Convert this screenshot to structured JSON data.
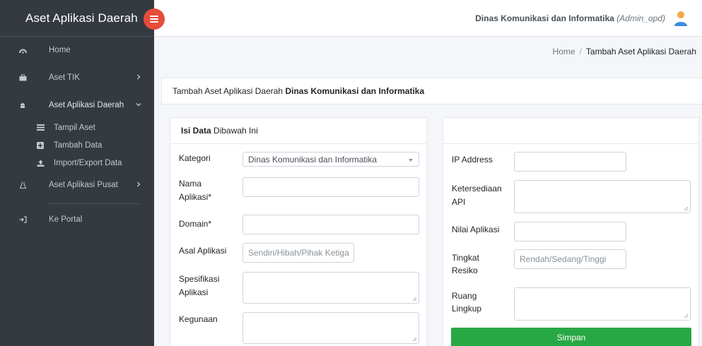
{
  "app": {
    "brand": "Aset Aplikasi Daerah"
  },
  "sidebar": {
    "items": [
      {
        "label": "Home",
        "icon": "dashboard-icon"
      },
      {
        "label": "Aset TIK",
        "icon": "briefcase-icon"
      },
      {
        "label": "Aset Aplikasi Daerah",
        "icon": "android-icon"
      },
      {
        "label": "Aset Aplikasi Pusat",
        "icon": "flask-icon"
      },
      {
        "label": "Ke Portal",
        "icon": "sign-in-icon"
      }
    ],
    "subitems": [
      {
        "label": "Tampil Aset",
        "icon": "list-icon"
      },
      {
        "label": "Tambah Data",
        "icon": "plus-square-icon"
      },
      {
        "label": "Import/Export Data",
        "icon": "upload-icon"
      }
    ]
  },
  "topbar": {
    "org": "Dinas Komunikasi dan Informatika",
    "role": "(Admin_opd)"
  },
  "breadcrumb": {
    "home": "Home",
    "sep": "/",
    "current": "Tambah Aset Aplikasi Daerah"
  },
  "title": {
    "prefix": "Tambah Aset Aplikasi Daerah",
    "org": "Dinas Komunikasi dan Informatika"
  },
  "left_card": {
    "header_bold": "Isi Data",
    "header_rest": "Dibawah Ini",
    "fields": {
      "kategori": {
        "label": "Kategori",
        "value": "Dinas Komunikasi dan Informatika"
      },
      "nama": {
        "label1": "Nama",
        "label2": "Aplikasi*",
        "value": ""
      },
      "domain": {
        "label": "Domain*",
        "value": ""
      },
      "asal": {
        "label": "Asal Aplikasi",
        "placeholder": "Sendiri/Hibah/Pihak Ketiga"
      },
      "spesifikasi": {
        "label1": "Spesifikasi",
        "label2": "Aplikasi",
        "value": ""
      },
      "kegunaan": {
        "label": "Kegunaan",
        "value": ""
      }
    }
  },
  "right_card": {
    "fields": {
      "ip": {
        "label": "IP Address",
        "value": ""
      },
      "api": {
        "label1": "Ketersediaan",
        "label2": "API",
        "value": ""
      },
      "nilai": {
        "label": "Nilai Aplikasi",
        "value": ""
      },
      "resiko": {
        "label1": "Tingkat",
        "label2": "Resiko",
        "placeholder": "Rendah/Sedang/Tinggi"
      },
      "ruang": {
        "label1": "Ruang",
        "label2": "Lingkup",
        "value": ""
      }
    },
    "save_label": "Simpan"
  },
  "colors": {
    "sidebar": "#343a40",
    "accent_red": "#e74c3c",
    "save_green": "#28a745"
  }
}
